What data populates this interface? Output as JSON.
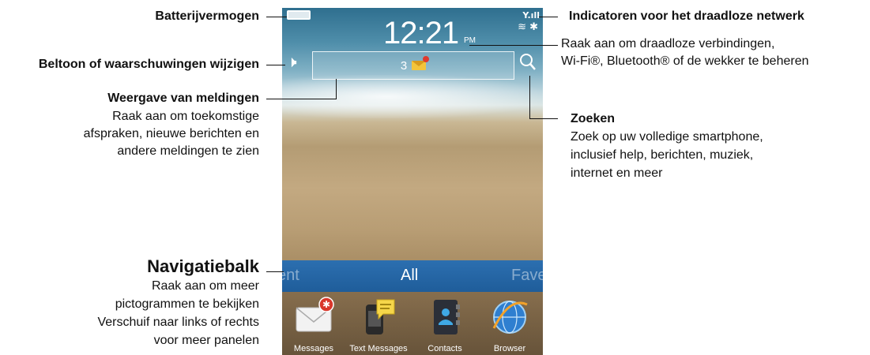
{
  "callouts": {
    "battery": "Batterijvermogen",
    "wireless": "Indicatoren voor het draadloze netwerk",
    "manage_line1": "Raak aan om draadloze verbindingen,",
    "manage_line2": "Wi-Fi®, Bluetooth® of de wekker te beheren",
    "ringtone": "Beltoon of waarschuwingen wijzigen",
    "notif_title": "Weergave van meldingen",
    "notif_line1": "Raak aan om toekomstige",
    "notif_line2": "afspraken, nieuwe berichten en",
    "notif_line3": "andere meldingen te zien",
    "search_title": "Zoeken",
    "search_line1": "Zoek op uw volledige smartphone,",
    "search_line2": "inclusief help, berichten, muziek,",
    "search_line3": "internet en meer",
    "nav_title": "Navigatiebalk",
    "nav_line1": "Raak aan om meer",
    "nav_line2": "pictogrammen te bekijken",
    "nav_line3": "Verschuif naar links of rechts",
    "nav_line4": "voor meer panelen"
  },
  "phone": {
    "time": "12:21",
    "ampm": "PM",
    "notification_count": "3",
    "nav": {
      "left": "ent",
      "center": "All",
      "right": "Fave"
    },
    "apps": [
      {
        "label": "Messages",
        "icon": "messages-icon"
      },
      {
        "label": "Text Messages",
        "icon": "text-messages-icon"
      },
      {
        "label": "Contacts",
        "icon": "contacts-icon"
      },
      {
        "label": "Browser",
        "icon": "browser-icon"
      }
    ]
  },
  "colors": {
    "navbar": "#1f5d9a",
    "envelope": "#f3c43a",
    "badge": "#e03a2e"
  }
}
